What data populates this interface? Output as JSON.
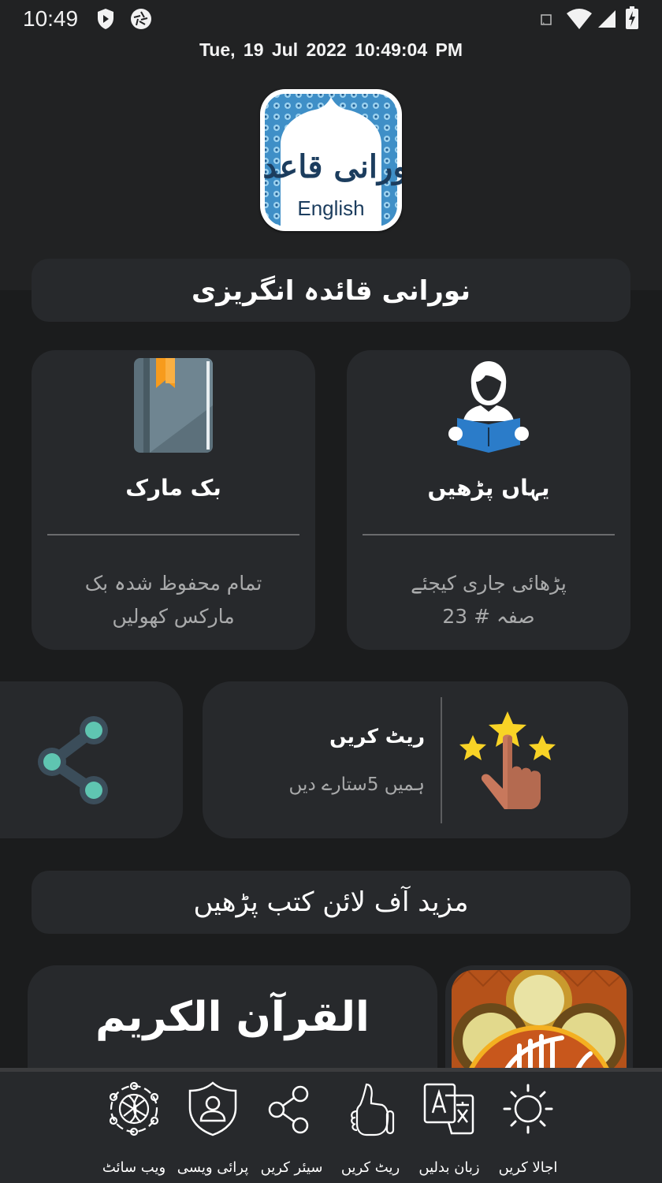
{
  "status_bar": {
    "time": "10:49",
    "left_icons": [
      "play-protect-icon",
      "camera-shutter-icon"
    ],
    "right_icons": [
      "cast-icon",
      "wifi-icon",
      "cell-signal-icon",
      "battery-charging-icon"
    ]
  },
  "header": {
    "datetime": "Tue, 19  Jul  2022   10:49:04 PM",
    "app_logo": {
      "icon": "noorani-qaida-logo",
      "calligraphy": "نورانی قاعدہ",
      "caption": "English",
      "colors": {
        "text": "#1c3d5e",
        "border_pattern": "#3f8fc7"
      }
    }
  },
  "title_banner": {
    "text": "نورانی قائدہ انگریزی"
  },
  "feature_cards": [
    {
      "id": "bookmark",
      "icon": "bookmark-book-icon",
      "title": "بک مارک",
      "subtitle_lines": [
        "تمام محفوظ شدہ بک",
        "مارکس کھولیں"
      ]
    },
    {
      "id": "read-here",
      "icon": "reading-person-icon",
      "title": "یہاں پڑھیں",
      "subtitle_lines": [
        "پڑھائی جاری کیجئے",
        "صفہ # 23"
      ]
    }
  ],
  "share_card": {
    "icon": "share-icon"
  },
  "rate_card": {
    "icon": "rate-stars-hand-icon",
    "title": "ریٹ کریں",
    "subtitle": "ہمیں 5ستارے دیں"
  },
  "more_books_banner": {
    "text": "مزید آف لائن کتب پڑھیں"
  },
  "book_list": [
    {
      "title": "القرآن الكريم",
      "thumbnail_icon": "quran-cover-icon"
    }
  ],
  "bottom_nav": {
    "items": [
      {
        "label": "اجالا کریں",
        "icon": "sun-icon"
      },
      {
        "label": "زبان بدلیں",
        "icon": "translate-icon"
      },
      {
        "label": "ریٹ کریں",
        "icon": "thumbs-up-icon"
      },
      {
        "label": "سیئر کریں",
        "icon": "share-icon"
      },
      {
        "label": "پرائی ویسی",
        "icon": "privacy-shield-icon"
      },
      {
        "label": "ویب سائٹ",
        "icon": "globe-network-icon"
      }
    ]
  },
  "colors": {
    "background": "#1b1c1d",
    "card": "#27292c",
    "subtext": "#a9aaab",
    "star": "#f8d326",
    "hand": "#c8785c",
    "share_node": "#5fc5b1",
    "book_blue": "#2b7cc9",
    "bookmark_orange": "#f79b1c"
  }
}
